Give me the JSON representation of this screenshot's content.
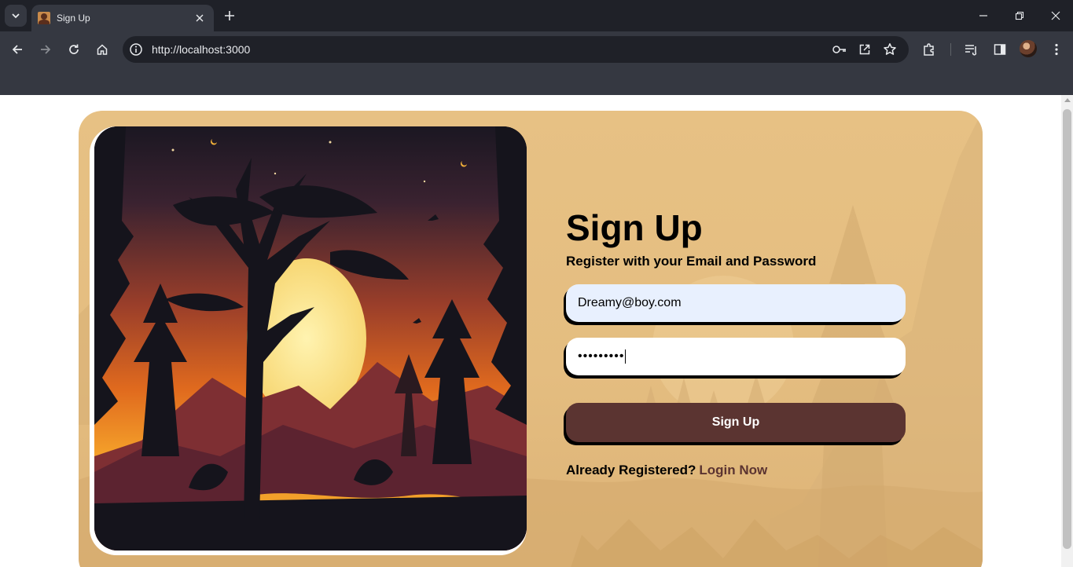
{
  "browser": {
    "tab_title": "Sign Up",
    "url": "http://localhost:3000"
  },
  "page": {
    "title": "Sign Up",
    "subtitle": "Register with your Email and Password",
    "email_value": "Dreamy@boy.com",
    "password_value": "•••••••••",
    "submit_label": "Sign Up",
    "footer_text": "Already Registered?",
    "footer_link": "Login Now"
  },
  "colors": {
    "card_bg": "#e4bd80",
    "button_bg": "#5b3431",
    "link": "#5b3431",
    "autofill_bg": "#e8f0fe"
  }
}
